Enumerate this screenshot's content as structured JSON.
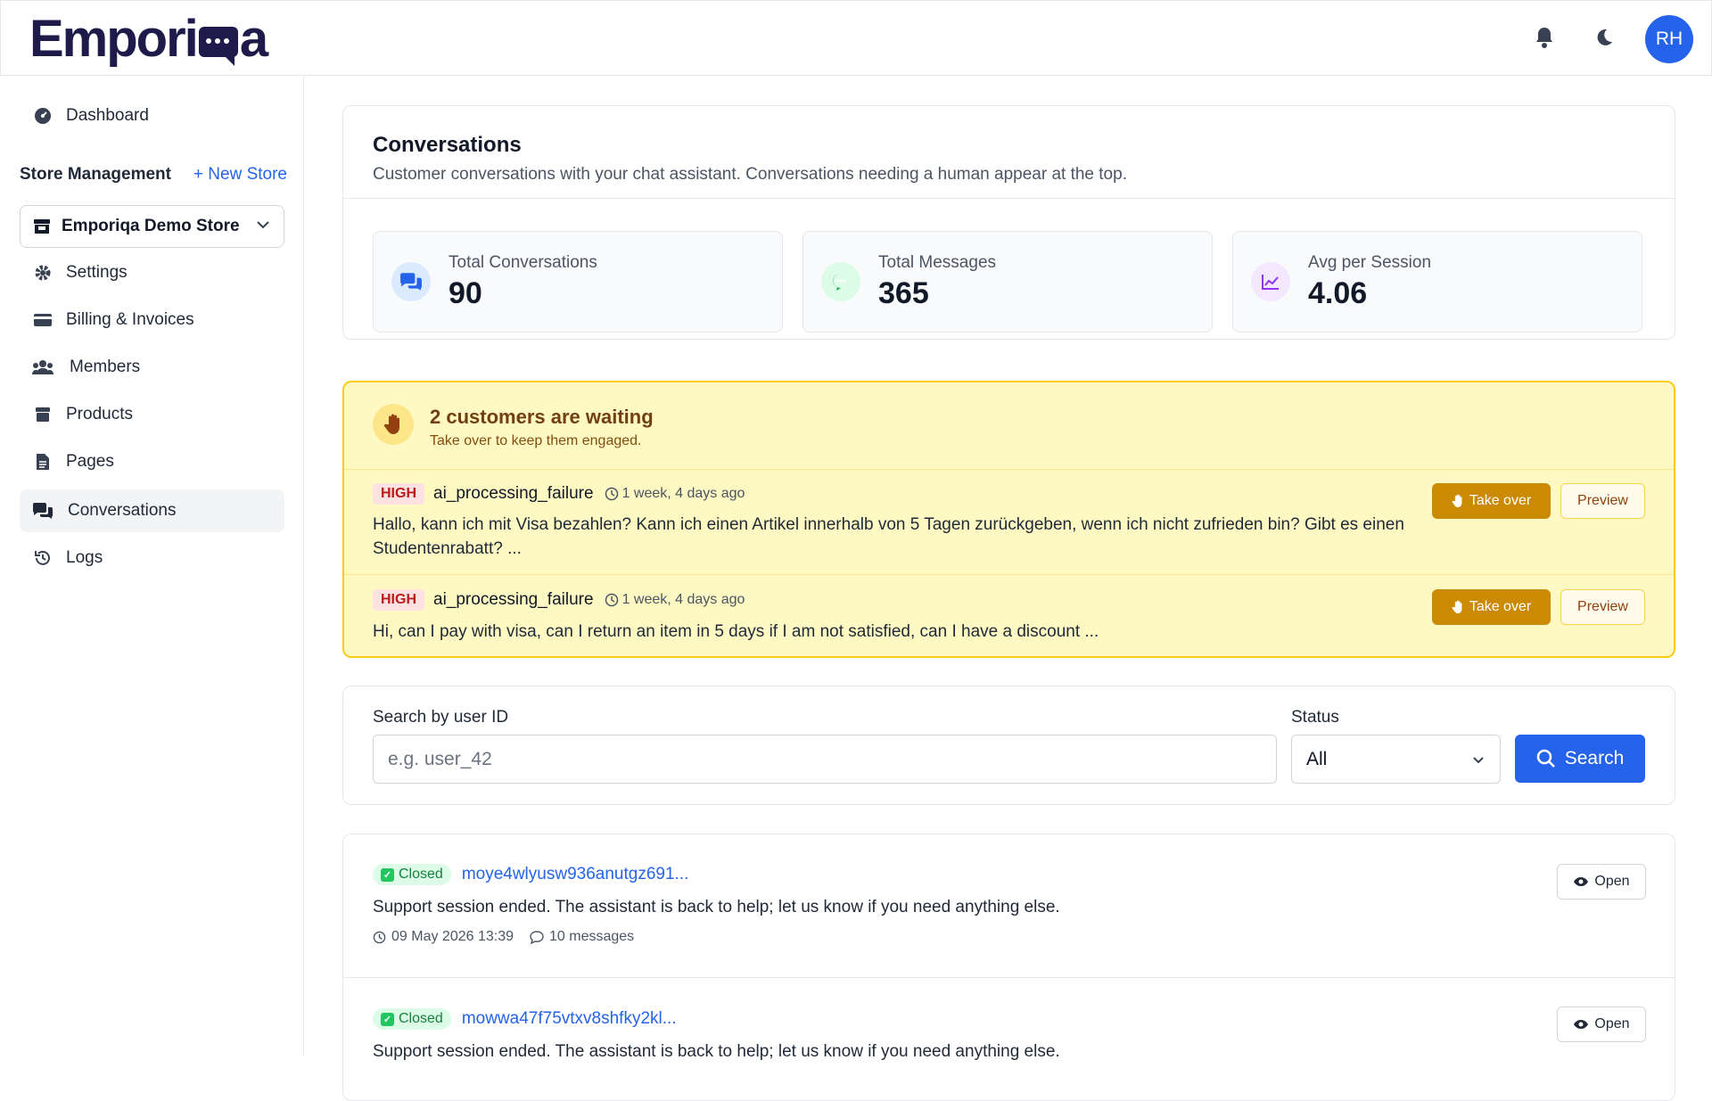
{
  "header": {
    "logo_left": "Empori",
    "logo_right": "a",
    "avatar_initials": "RH",
    "icons": [
      "bell-icon",
      "moon-icon"
    ]
  },
  "sidebar": {
    "dashboard": "Dashboard",
    "store_management": "Store Management",
    "new_store": "+ New Store",
    "store_selected": "Emporiqa Demo Store",
    "items": [
      {
        "label": "Settings",
        "icon": "gear-icon"
      },
      {
        "label": "Billing & Invoices",
        "icon": "credit-card-icon"
      },
      {
        "label": "Members",
        "icon": "users-icon"
      },
      {
        "label": "Products",
        "icon": "box-icon"
      },
      {
        "label": "Pages",
        "icon": "file-icon"
      },
      {
        "label": "Conversations",
        "icon": "chat-icon",
        "active": true
      },
      {
        "label": "Logs",
        "icon": "history-icon"
      }
    ]
  },
  "overview": {
    "title": "Conversations",
    "subtitle": "Customer conversations with your chat assistant. Conversations needing a human appear at the top.",
    "stats": [
      {
        "label": "Total Conversations",
        "value": "90",
        "icon": "chat-bubbles-icon",
        "color": "#2563eb",
        "bg": "#dbeafe"
      },
      {
        "label": "Total Messages",
        "value": "365",
        "icon": "message-dots-icon",
        "color": "#16a34a",
        "bg": "#dcfce7"
      },
      {
        "label": "Avg per Session",
        "value": "4.06",
        "icon": "trend-chart-icon",
        "color": "#9333ea",
        "bg": "#f3e8ff"
      }
    ]
  },
  "waiting": {
    "title": "2 customers are waiting",
    "subtitle": "Take over to keep them engaged.",
    "take_over_label": "Take over",
    "preview_label": "Preview",
    "rows": [
      {
        "priority": "HIGH",
        "reason": "ai_processing_failure",
        "time": "1 week, 4 days ago",
        "message": "Hallo, kann ich mit Visa bezahlen? Kann ich einen Artikel innerhalb von 5 Tagen zurückgeben, wenn ich nicht zufrieden bin? Gibt es einen Studentenrabatt? ..."
      },
      {
        "priority": "HIGH",
        "reason": "ai_processing_failure",
        "time": "1 week, 4 days ago",
        "message": "Hi, can I pay with visa, can I return an item in 5 days if I am not satisfied, can I have a discount ..."
      }
    ]
  },
  "search": {
    "label": "Search by user ID",
    "placeholder": "e.g. user_42",
    "status_label": "Status",
    "status_value": "All",
    "button": "Search"
  },
  "conversations": [
    {
      "status": "Closed",
      "id": "moye4wlyusw936anutgz691...",
      "message": "Support session ended. The assistant is back to help; let us know if you need anything else.",
      "date": "09 May 2026 13:39",
      "count": "10 messages",
      "open_label": "Open"
    },
    {
      "status": "Closed",
      "id": "mowwa47f75vtxv8shfky2kl...",
      "message": "Support session ended. The assistant is back to help; let us know if you need anything else.",
      "open_label": "Open"
    }
  ]
}
